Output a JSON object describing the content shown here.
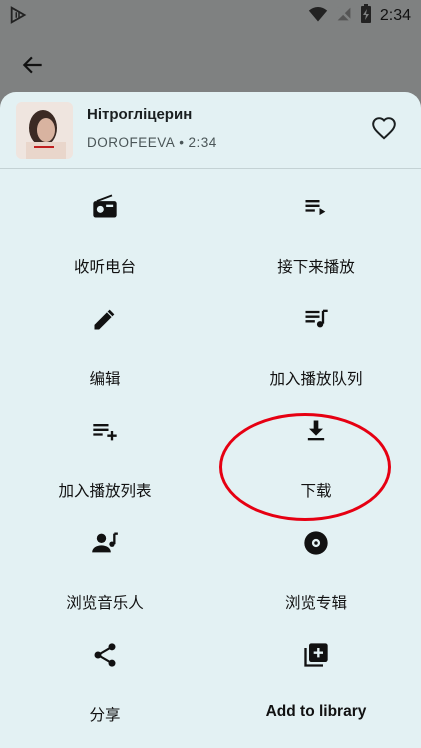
{
  "status_bar": {
    "time": "2:34",
    "icons": [
      "app-notification-icon",
      "wifi-icon",
      "no-signal-icon",
      "battery-charging-icon"
    ]
  },
  "track": {
    "title": "Нітрогліцерин",
    "artist": "DOROFEEVA",
    "separator": "•",
    "duration": "2:34"
  },
  "actions": [
    {
      "label": "收听电台",
      "icon": "radio-icon"
    },
    {
      "label": "接下来播放",
      "icon": "play-next-icon"
    },
    {
      "label": "编辑",
      "icon": "edit-pencil-icon"
    },
    {
      "label": "加入播放队列",
      "icon": "queue-music-icon"
    },
    {
      "label": "加入播放列表",
      "icon": "playlist-add-icon"
    },
    {
      "label": "下载",
      "icon": "download-icon"
    },
    {
      "label": "浏览音乐人",
      "icon": "artist-icon"
    },
    {
      "label": "浏览专辑",
      "icon": "album-disc-icon"
    },
    {
      "label": "分享",
      "icon": "share-icon"
    },
    {
      "label": "Add to library",
      "icon": "library-add-icon"
    }
  ],
  "colors": {
    "overlay": "#7f8181",
    "sheet": "#e3f1f3",
    "highlight_circle": "#e60012"
  }
}
